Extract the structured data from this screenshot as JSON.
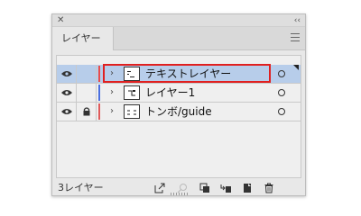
{
  "panel": {
    "tab_label": "レイヤー",
    "layer_count": "3レイヤー"
  },
  "layers": [
    {
      "name": "テキストレイヤー",
      "color": "#e84c4c",
      "locked": false,
      "visible": true,
      "selected": true
    },
    {
      "name": "レイヤー1",
      "color": "#4a6fe0",
      "locked": false,
      "visible": true,
      "selected": false
    },
    {
      "name": "トンボ/guide",
      "color": "#e05a5a",
      "locked": true,
      "visible": true,
      "selected": false
    }
  ],
  "highlight_color": "#e02020",
  "icons": {
    "close": "close-icon",
    "collapse": "collapse-icon",
    "panel_menu": "hamburger-menu-icon",
    "visibility": "eye-icon",
    "lock": "lock-icon",
    "expand": "chevron-right-icon",
    "target": "target-circle-icon",
    "export": "export-icon",
    "search": "search-icon",
    "clipping_mask": "clipping-mask-icon",
    "new_sublayer": "new-sublayer-icon",
    "new_layer": "new-layer-icon",
    "delete": "trash-icon"
  }
}
